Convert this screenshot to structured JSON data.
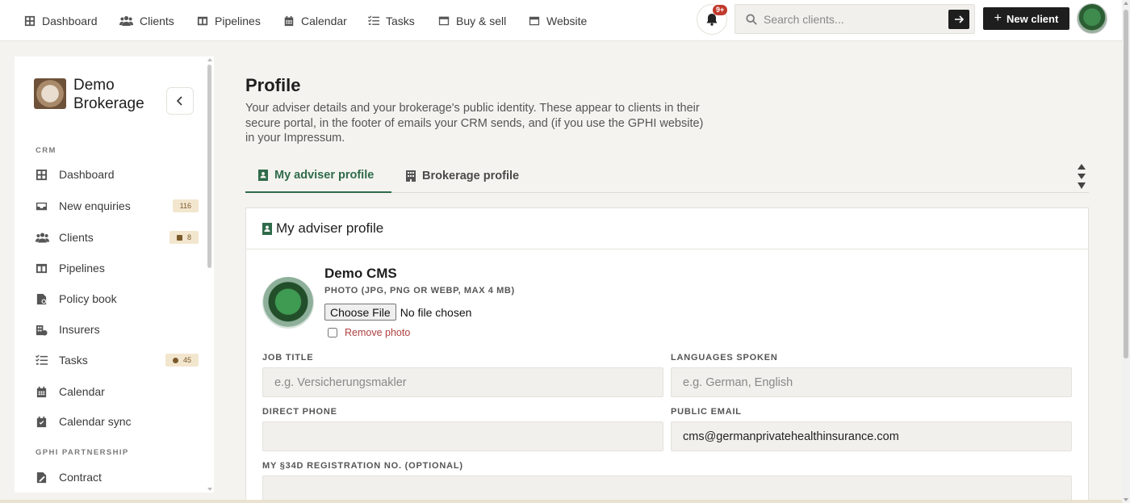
{
  "topnav": {
    "items": [
      {
        "label": "Dashboard",
        "icon": "grid-icon"
      },
      {
        "label": "Clients",
        "icon": "users-icon"
      },
      {
        "label": "Pipelines",
        "icon": "columns-icon"
      },
      {
        "label": "Calendar",
        "icon": "calendar-icon"
      },
      {
        "label": "Tasks",
        "icon": "checklist-icon"
      },
      {
        "label": "Buy & sell",
        "icon": "inbox-icon"
      },
      {
        "label": "Website",
        "icon": "browser-icon"
      }
    ],
    "notification_count": "9+",
    "search_placeholder": "Search clients...",
    "new_client_label": "New client"
  },
  "sidebar": {
    "brand_name": "Demo Brokerage",
    "section_crm": "CRM",
    "items": [
      {
        "label": "Dashboard",
        "icon": "grid-icon"
      },
      {
        "label": "New enquiries",
        "icon": "inbox-icon",
        "badge": "116"
      },
      {
        "label": "Clients",
        "icon": "users-icon",
        "badge": "8"
      },
      {
        "label": "Pipelines",
        "icon": "columns-icon"
      },
      {
        "label": "Policy book",
        "icon": "file-search-icon"
      },
      {
        "label": "Insurers",
        "icon": "building-icon"
      },
      {
        "label": "Tasks",
        "icon": "checklist-icon",
        "badge": "45"
      },
      {
        "label": "Calendar",
        "icon": "calendar-icon"
      },
      {
        "label": "Calendar sync",
        "icon": "calendar-check-icon"
      }
    ],
    "section_partnership": "GPHI PARTNERSHIP",
    "partnership_items": [
      {
        "label": "Contract",
        "icon": "contract-icon"
      }
    ]
  },
  "main": {
    "title": "Profile",
    "description": "Your adviser details and your brokerage's public identity. These appear to clients in their secure portal, in the footer of emails your CRM sends, and (if you use the GPHI website) in your Impressum.",
    "tabs": [
      {
        "label": "My adviser profile",
        "active": true
      },
      {
        "label": "Brokerage profile",
        "active": false
      }
    ],
    "card": {
      "title": "My adviser profile",
      "name": "Demo CMS",
      "photo_hint": "PHOTO (JPG, PNG OR WEBP, MAX 4 MB)",
      "choose_file": "Choose File",
      "file_status": "No file chosen",
      "remove_photo": "Remove photo",
      "fields": {
        "job_title_label": "JOB TITLE",
        "job_title_placeholder": "e.g. Versicherungsmakler",
        "languages_label": "LANGUAGES SPOKEN",
        "languages_placeholder": "e.g. German, English",
        "phone_label": "DIRECT PHONE",
        "phone_value": "",
        "email_label": "PUBLIC EMAIL",
        "email_value": "cms@germanprivatehealthinsurance.com",
        "registration_label": "MY §34D REGISTRATION NO. (OPTIONAL)",
        "registration_value": ""
      }
    }
  },
  "colors": {
    "accent": "#2f6b4a",
    "badge_bg": "#f3e6cf",
    "danger": "#b04040"
  }
}
